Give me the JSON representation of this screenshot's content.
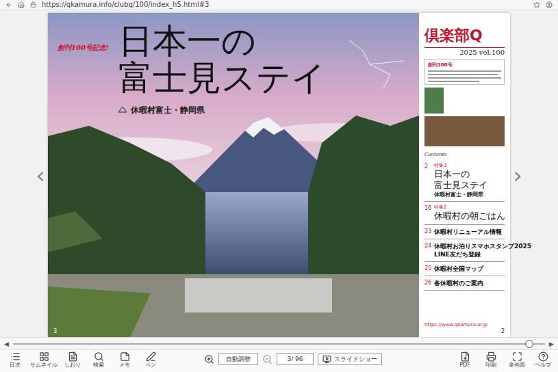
{
  "browser": {
    "url": "https://qkamura.info/clubq/100/index_h5.html#3"
  },
  "viewer": {
    "prev": "‹",
    "next": "›"
  },
  "left_page": {
    "badge": "創刊100号記念!",
    "title": [
      "日本一の",
      "富士見ステイ"
    ],
    "subtitle": "休暇村富士・静岡県",
    "page": "3"
  },
  "right_page": {
    "brand": "倶楽部Q",
    "issue": "2025 vol.100",
    "notice": "創刊100号",
    "contents_label": "Contents",
    "contents": [
      {
        "page": "2",
        "tag": "特集1",
        "lines": [
          "日本一の",
          "富士見ステイ"
        ],
        "sub": "休暇村富士・静岡県",
        "featured": true
      },
      {
        "page": "16",
        "tag": "特集2",
        "lines": [
          "休暇村の朝ごはん"
        ],
        "sub": "",
        "featured": true
      },
      {
        "page": "23",
        "tag": "",
        "lines": [
          "休暇村リニューアル情報"
        ],
        "sub": "",
        "featured": false
      },
      {
        "page": "24",
        "tag": "",
        "lines": [
          "休暇村お泊りスマホスタンプ2025",
          "LINE友だち登録"
        ],
        "sub": "",
        "featured": false
      },
      {
        "page": "25",
        "tag": "",
        "lines": [
          "休暇村全国マップ"
        ],
        "sub": "",
        "featured": false
      },
      {
        "page": "26",
        "tag": "",
        "lines": [
          "各休暇村のご案内"
        ],
        "sub": "",
        "featured": false
      }
    ],
    "url": "https://www.qkamura.or.jp",
    "page": "2"
  },
  "slider": {
    "prev": "◀",
    "next": "▶",
    "level": 0.97
  },
  "toolbar": {
    "left": [
      {
        "label": "目次"
      },
      {
        "label": "サムネイル"
      },
      {
        "label": "しおり"
      },
      {
        "label": "検索"
      },
      {
        "label": "メモ"
      },
      {
        "label": "ペン"
      }
    ],
    "zoom_mode": "自動調整",
    "page_field": "3/ 96",
    "slideshow": "スライドショー",
    "right": [
      {
        "label": "PDF"
      },
      {
        "label": "印刷"
      },
      {
        "label": "全画面"
      },
      {
        "label": "ヘルプ"
      }
    ]
  }
}
